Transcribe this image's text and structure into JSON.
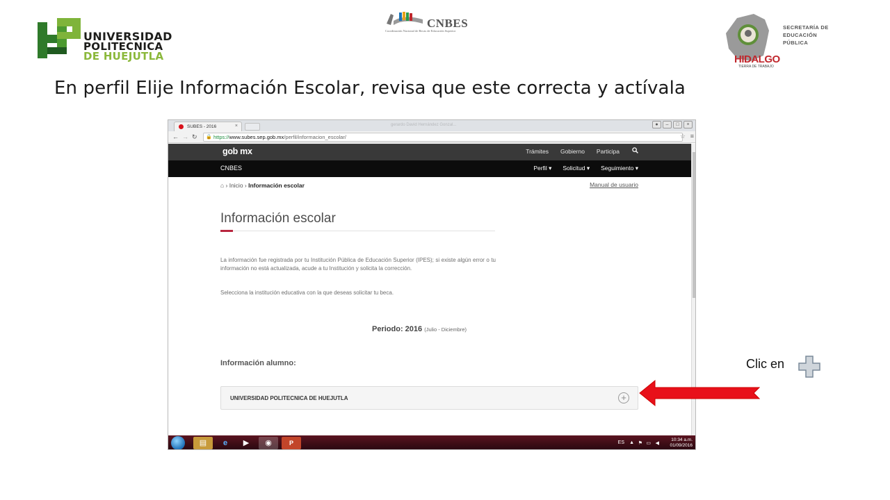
{
  "logos": {
    "upn": {
      "line1": "UNIVERSIDAD",
      "line2": "POLITECNICA",
      "line3": "DE HUEJUTLA"
    },
    "cnbes": {
      "word": "CNBES",
      "subtitle": "Coordinación Nacional de Becas de Educación Superior"
    },
    "sep": {
      "line1": "SECRETARÍA DE",
      "line2": "EDUCACIÓN",
      "line3": "PÚBLICA",
      "state": "HIDALGO",
      "tagline": "TIERRA DE TRABAJO"
    }
  },
  "slide": {
    "title": "En perfil Elije Información Escolar, revisa que este correcta y actívala",
    "callout_text": "Clic en",
    "arrow_color": "#e8101a"
  },
  "browser": {
    "tab_title": "SUBES - 2016",
    "ghost_title": "gerardo David Hernández Gonzal...",
    "url_scheme": "https://",
    "url_host": "www.subes.sep.gob.mx",
    "url_path": "/perfil/informacion_escolar/"
  },
  "site": {
    "brand": "gob mx",
    "top_links": [
      "Trámites",
      "Gobierno",
      "Participa"
    ],
    "section_name": "CNBES",
    "menu": [
      "Perfil ▾",
      "Solicitud ▾",
      "Seguimiento ▾"
    ],
    "breadcrumb": {
      "home": "Inicio",
      "current": "Información escolar"
    },
    "manual_link": "Manual de usuario",
    "heading": "Información escolar",
    "paragraph1": "La información fue registrada por tu Institución Pública de Educación Superior (IPES); si existe algún error o tu información no está actualizada, acude a tu Institución y solicita la corrección.",
    "paragraph2": "Selecciona la institución educativa con la que deseas solicitar tu beca.",
    "periodo_label": "Periodo: 2016",
    "periodo_detail": "(Julio - Diciembre)",
    "alumno_label": "Información alumno:",
    "institution": "UNIVERSIDAD POLITECNICA DE HUEJUTLA",
    "accent_color": "#b8263f"
  },
  "taskbar": {
    "lang": "ES",
    "time": "10:34 a.m.",
    "date": "01/09/2016"
  }
}
